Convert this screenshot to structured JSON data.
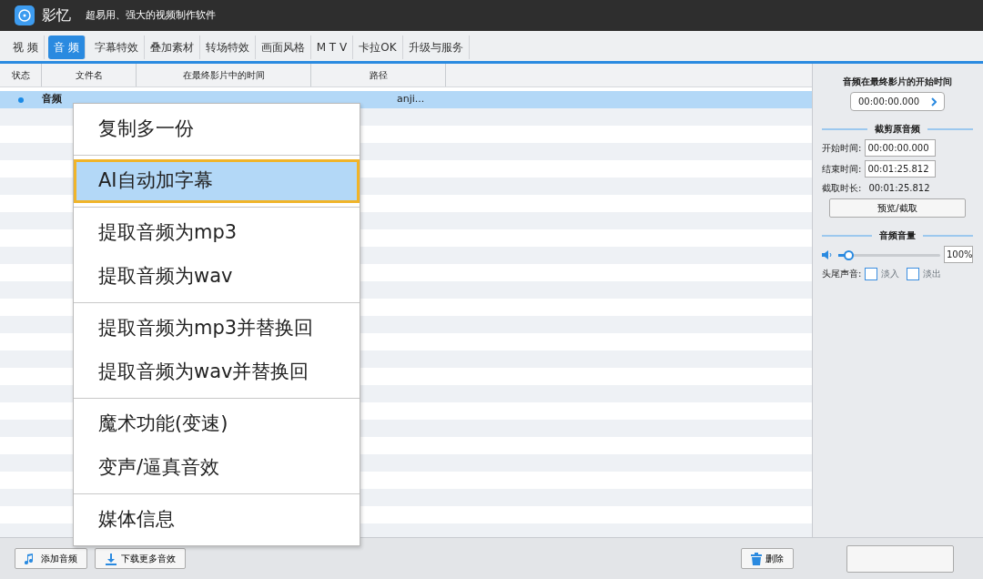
{
  "window": {
    "title": "影忆",
    "subtitle": "超易用、强大的视频制作软件"
  },
  "tabs": [
    {
      "label": "视 频",
      "selected": false
    },
    {
      "label": "音 频",
      "selected": true
    },
    {
      "label": "字幕特效",
      "selected": false
    },
    {
      "label": "叠加素材",
      "selected": false
    },
    {
      "label": "转场特效",
      "selected": false
    },
    {
      "label": "画面风格",
      "selected": false
    },
    {
      "label": "M T V",
      "selected": false
    },
    {
      "label": "卡拉OK",
      "selected": false
    },
    {
      "label": "升级与服务",
      "selected": false
    }
  ],
  "table": {
    "columns": [
      "状态",
      "文件名",
      "在最终影片中的时间",
      "路径"
    ],
    "rows": [
      {
        "name": "音频",
        "path": "anji...",
        "selected": true
      }
    ]
  },
  "context_menu": {
    "groups": [
      [
        {
          "label": "复制多一份",
          "selected": false
        }
      ],
      [
        {
          "label": "AI自动加字幕",
          "selected": true
        }
      ],
      [
        {
          "label": "提取音频为mp3",
          "selected": false
        },
        {
          "label": "提取音频为wav",
          "selected": false
        }
      ],
      [
        {
          "label": "提取音频为mp3并替换回",
          "selected": false
        },
        {
          "label": "提取音频为wav并替换回",
          "selected": false
        }
      ],
      [
        {
          "label": "魔术功能(变速)",
          "selected": false
        },
        {
          "label": "变声/逼真音效",
          "selected": false
        }
      ],
      [
        {
          "label": "媒体信息",
          "selected": false
        }
      ]
    ]
  },
  "side_panel": {
    "start_title": "音频在最终影片的开始时间",
    "start_value": "00:00:00.000",
    "trim_title": "截剪原音频",
    "begin_label": "开始时间:",
    "begin_value": "00:00:00.000",
    "end_label": "结束时间:",
    "end_value": "00:01:25.812",
    "duration_label": "截取时长:",
    "duration_value": "00:01:25.812",
    "preview_button": "预览/截取",
    "volume_title": "音频音量",
    "volume": {
      "level": 0.1,
      "reading": "100%"
    },
    "fade_label": "头尾声音:",
    "fade_in": {
      "label": "淡入",
      "checked": false
    },
    "fade_out": {
      "label": "淡出",
      "checked": false
    }
  },
  "bottom_buttons": [
    "添加音频",
    "下载更多音效",
    "删除"
  ]
}
